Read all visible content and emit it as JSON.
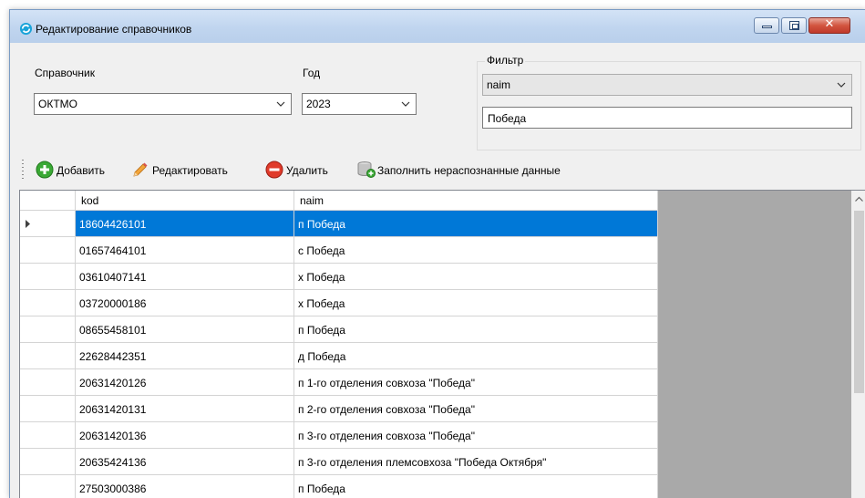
{
  "window": {
    "title": "Редактирование справочников",
    "close_glyph": "✕"
  },
  "form": {
    "ref_label": "Справочник",
    "ref_value": "ОКТМО",
    "year_label": "Год",
    "year_value": "2023",
    "filter_legend": "Фильтр",
    "filter_field_value": "naim",
    "filter_text_value": "Победа"
  },
  "toolbar": {
    "add_label": "Добавить",
    "edit_label": "Редактировать",
    "delete_label": "Удалить",
    "fill_label": "Заполнить нераспознанные данные"
  },
  "grid": {
    "columns": [
      "kod",
      "naim"
    ],
    "selected_row": 0,
    "rows": [
      {
        "kod": "18604426101",
        "naim": "п Победа"
      },
      {
        "kod": "01657464101",
        "naim": "с Победа"
      },
      {
        "kod": "03610407141",
        "naim": "х Победа"
      },
      {
        "kod": "03720000186",
        "naim": "х Победа"
      },
      {
        "kod": "08655458101",
        "naim": "п Победа"
      },
      {
        "kod": "22628442351",
        "naim": "д Победа"
      },
      {
        "kod": "20631420126",
        "naim": "п 1-го отделения совхоза \"Победа\""
      },
      {
        "kod": "20631420131",
        "naim": "п 2-го отделения совхоза \"Победа\""
      },
      {
        "kod": "20631420136",
        "naim": "п 3-го отделения совхоза \"Победа\""
      },
      {
        "kod": "20635424136",
        "naim": "п 3-го отделения племсовхоза \"Победа Октября\""
      },
      {
        "kod": "27503000386",
        "naim": "п Победа"
      }
    ]
  },
  "colors": {
    "selection": "#0078d7",
    "window_bg": "#f0f0f0",
    "grid_bg": "#a9a9a9"
  },
  "icons": {
    "app": "refresh-globe-icon",
    "add": "green-plus-icon",
    "edit": "pencil-icon",
    "delete": "red-minus-icon",
    "fill": "database-fill-icon",
    "row_indicator": "triangle-right-icon"
  }
}
